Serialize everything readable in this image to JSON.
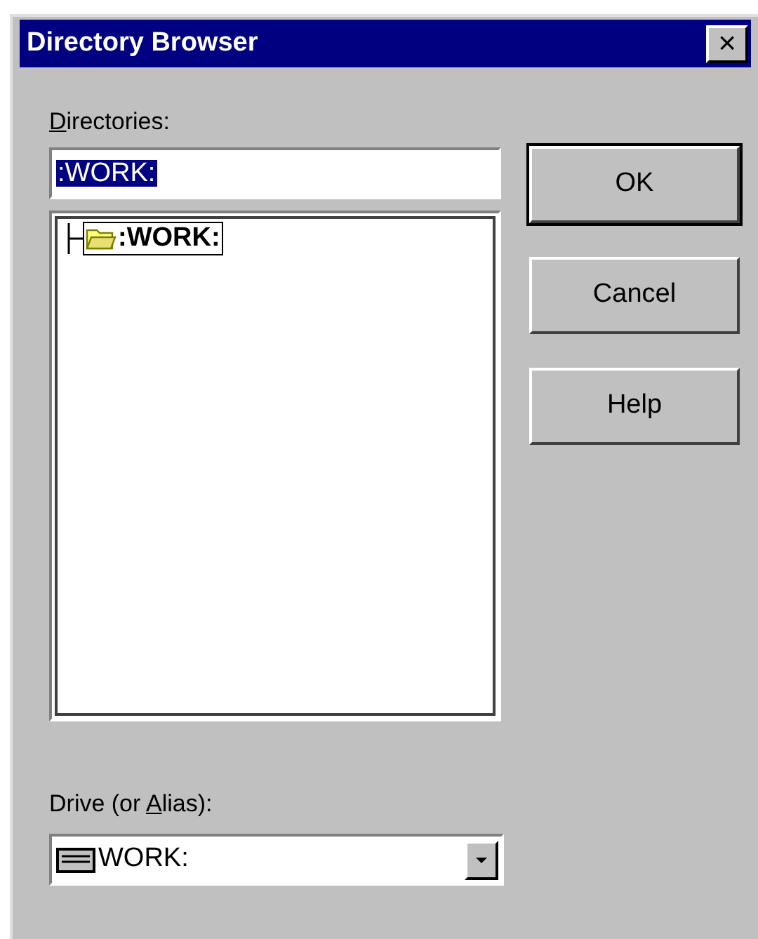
{
  "window": {
    "title": "Directory Browser",
    "close": "×"
  },
  "directories": {
    "label_parts": {
      "key": "D",
      "after": "irectories:"
    },
    "value": ":WORK:",
    "value_selected": true
  },
  "tree": {
    "items": [
      {
        "label": ":WORK:",
        "expanded": true,
        "selected": true
      }
    ]
  },
  "drive": {
    "label_parts": {
      "before": "Drive (or ",
      "key": "A",
      "after": "lias):"
    },
    "value": "WORK:"
  },
  "buttons": [
    {
      "label": "OK",
      "default": true
    },
    {
      "label": "Cancel",
      "default": false
    },
    {
      "label": "Help",
      "default": false
    }
  ]
}
